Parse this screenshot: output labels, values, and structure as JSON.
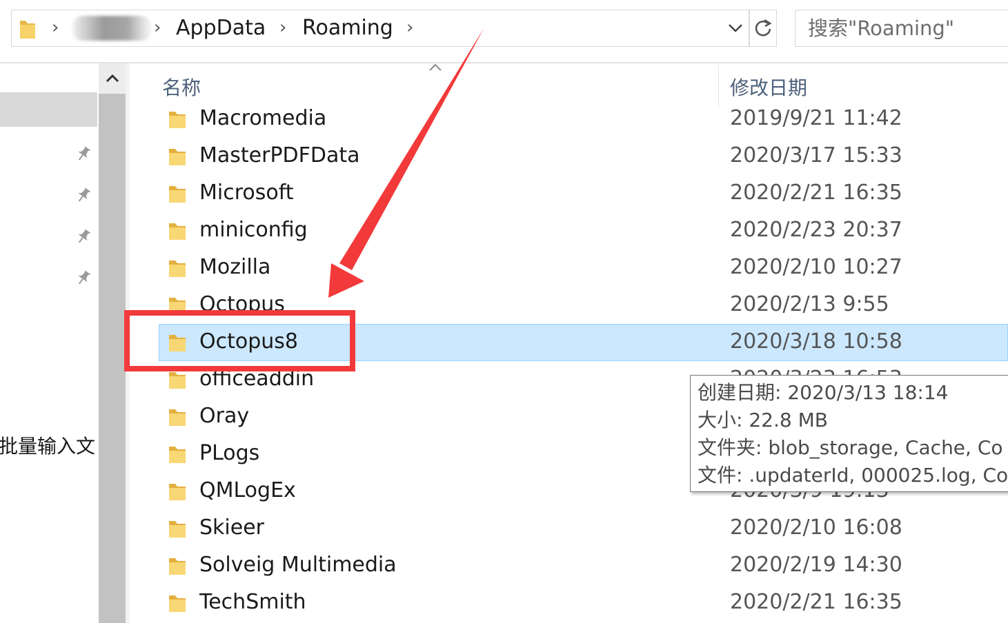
{
  "address_bar": {
    "crumbs": [
      "AppData",
      "Roaming"
    ],
    "search_placeholder": "搜索\"Roaming\""
  },
  "nav_pane": {
    "partial_item_text": "批量输入文"
  },
  "columns": {
    "name": "名称",
    "date_modified": "修改日期"
  },
  "files": [
    {
      "name": "Macromedia",
      "date": "2019/9/21 11:42"
    },
    {
      "name": "MasterPDFData",
      "date": "2020/3/17 15:33"
    },
    {
      "name": "Microsoft",
      "date": "2020/2/21 16:35"
    },
    {
      "name": "miniconfig",
      "date": "2020/2/23 20:37"
    },
    {
      "name": "Mozilla",
      "date": "2020/2/10 10:27"
    },
    {
      "name": "Octopus",
      "date": "2020/2/13 9:55"
    },
    {
      "name": "Octopus8",
      "date": "2020/3/18 10:58",
      "selected": true
    },
    {
      "name": "officeaddin",
      "date": "2020/3/23 16:53"
    },
    {
      "name": "Oray",
      "date": ""
    },
    {
      "name": "PLogs",
      "date": ""
    },
    {
      "name": "QMLogEx",
      "date": "2020/3/9 19:13"
    },
    {
      "name": "Skieer",
      "date": "2020/2/10 16:08"
    },
    {
      "name": "Solveig Multimedia",
      "date": "2020/2/19 14:30"
    },
    {
      "name": "TechSmith",
      "date": "2020/2/21 16:35"
    }
  ],
  "tooltip": {
    "created": "创建日期: 2020/3/13 18:14",
    "size": "大小: 22.8 MB",
    "folders": "文件夹: blob_storage, Cache, Co",
    "files": "文件: .updaterId, 000025.log, Co"
  },
  "colors": {
    "selection_fill": "#cce8ff",
    "selection_border": "#99d1ff",
    "annotation_red": "#f23a3a",
    "header_text": "#4c607a"
  },
  "icons": [
    "folder-icon",
    "chevron-right-icon",
    "chevron-down-icon",
    "refresh-icon",
    "pin-icon",
    "scroll-up-icon",
    "sort-up-icon"
  ]
}
